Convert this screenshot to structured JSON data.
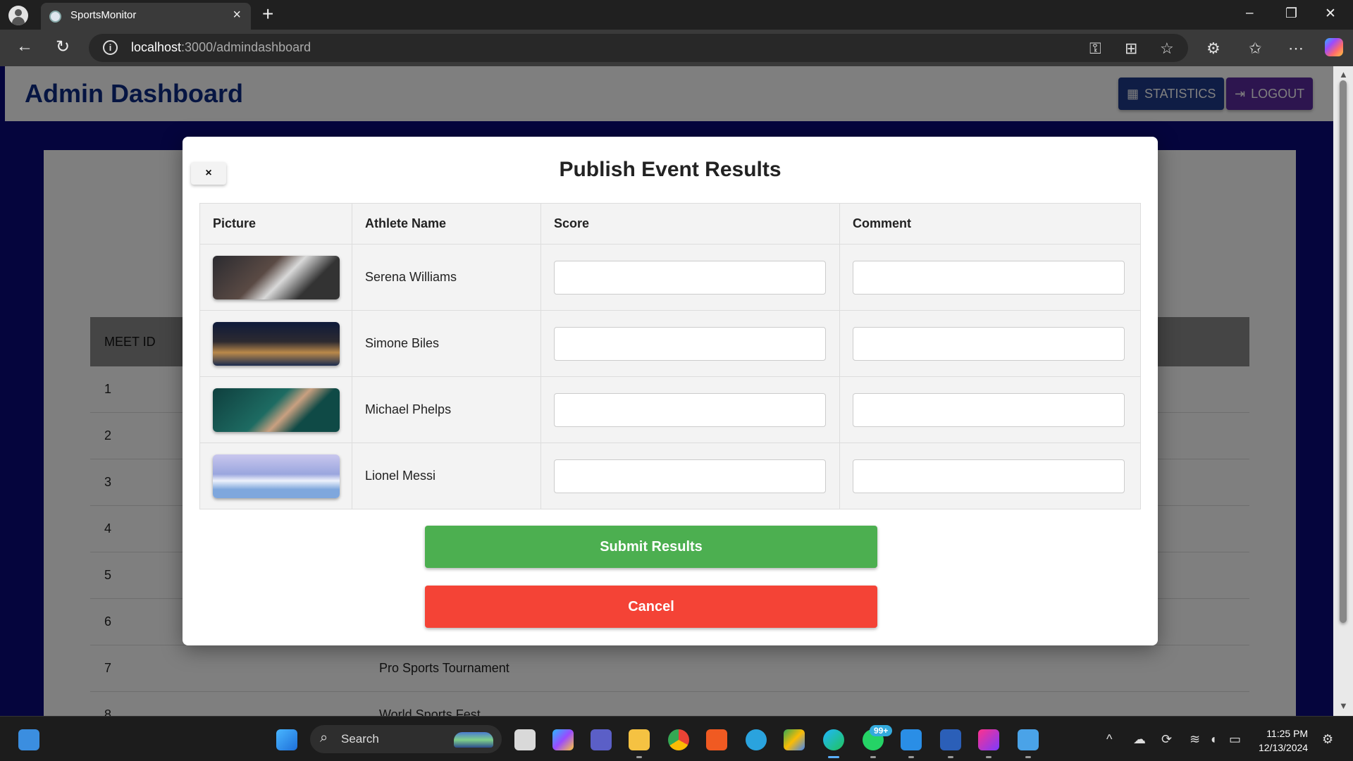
{
  "browser": {
    "tab_title": "SportsMonitor",
    "url_host": "localhost",
    "url_path": ":3000/admindashboard"
  },
  "app": {
    "title": "Admin Dashboard",
    "statistics_label": "STATISTICS",
    "logout_label": "LOGOUT",
    "table_header": "MEET ID",
    "rows": [
      {
        "id": "1",
        "name": ""
      },
      {
        "id": "2",
        "name": ""
      },
      {
        "id": "3",
        "name": ""
      },
      {
        "id": "4",
        "name": ""
      },
      {
        "id": "5",
        "name": ""
      },
      {
        "id": "6",
        "name": ""
      },
      {
        "id": "7",
        "name": "Pro Sports Tournament"
      },
      {
        "id": "8",
        "name": "World Sports Fest"
      }
    ]
  },
  "modal": {
    "close_label": "×",
    "title": "Publish Event Results",
    "columns": [
      "Picture",
      "Athlete Name",
      "Score",
      "Comment"
    ],
    "athletes": [
      {
        "name": "Serena Williams",
        "score": "",
        "comment": ""
      },
      {
        "name": "Simone Biles",
        "score": "",
        "comment": ""
      },
      {
        "name": "Michael Phelps",
        "score": "",
        "comment": ""
      },
      {
        "name": "Lionel Messi",
        "score": "",
        "comment": ""
      }
    ],
    "submit_label": "Submit Results",
    "cancel_label": "Cancel"
  },
  "taskbar": {
    "search_label": "Search",
    "whatsapp_badge": "99+",
    "time": "11:25 PM",
    "date": "12/13/2024"
  },
  "colors": {
    "submit": "#4caf50",
    "cancel": "#f44336",
    "statistics": "#1e3a8a",
    "logout": "#5b2a9e",
    "title": "#0d2a85"
  }
}
